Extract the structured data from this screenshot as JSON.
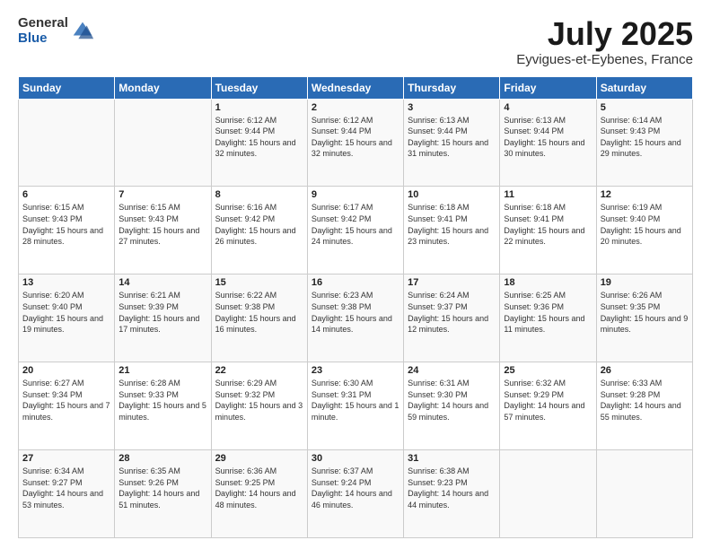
{
  "logo": {
    "general": "General",
    "blue": "Blue"
  },
  "header": {
    "month": "July 2025",
    "location": "Eyvigues-et-Eybenes, France"
  },
  "weekdays": [
    "Sunday",
    "Monday",
    "Tuesday",
    "Wednesday",
    "Thursday",
    "Friday",
    "Saturday"
  ],
  "weeks": [
    [
      {
        "day": "",
        "info": ""
      },
      {
        "day": "",
        "info": ""
      },
      {
        "day": "1",
        "info": "Sunrise: 6:12 AM\nSunset: 9:44 PM\nDaylight: 15 hours and 32 minutes."
      },
      {
        "day": "2",
        "info": "Sunrise: 6:12 AM\nSunset: 9:44 PM\nDaylight: 15 hours and 32 minutes."
      },
      {
        "day": "3",
        "info": "Sunrise: 6:13 AM\nSunset: 9:44 PM\nDaylight: 15 hours and 31 minutes."
      },
      {
        "day": "4",
        "info": "Sunrise: 6:13 AM\nSunset: 9:44 PM\nDaylight: 15 hours and 30 minutes."
      },
      {
        "day": "5",
        "info": "Sunrise: 6:14 AM\nSunset: 9:43 PM\nDaylight: 15 hours and 29 minutes."
      }
    ],
    [
      {
        "day": "6",
        "info": "Sunrise: 6:15 AM\nSunset: 9:43 PM\nDaylight: 15 hours and 28 minutes."
      },
      {
        "day": "7",
        "info": "Sunrise: 6:15 AM\nSunset: 9:43 PM\nDaylight: 15 hours and 27 minutes."
      },
      {
        "day": "8",
        "info": "Sunrise: 6:16 AM\nSunset: 9:42 PM\nDaylight: 15 hours and 26 minutes."
      },
      {
        "day": "9",
        "info": "Sunrise: 6:17 AM\nSunset: 9:42 PM\nDaylight: 15 hours and 24 minutes."
      },
      {
        "day": "10",
        "info": "Sunrise: 6:18 AM\nSunset: 9:41 PM\nDaylight: 15 hours and 23 minutes."
      },
      {
        "day": "11",
        "info": "Sunrise: 6:18 AM\nSunset: 9:41 PM\nDaylight: 15 hours and 22 minutes."
      },
      {
        "day": "12",
        "info": "Sunrise: 6:19 AM\nSunset: 9:40 PM\nDaylight: 15 hours and 20 minutes."
      }
    ],
    [
      {
        "day": "13",
        "info": "Sunrise: 6:20 AM\nSunset: 9:40 PM\nDaylight: 15 hours and 19 minutes."
      },
      {
        "day": "14",
        "info": "Sunrise: 6:21 AM\nSunset: 9:39 PM\nDaylight: 15 hours and 17 minutes."
      },
      {
        "day": "15",
        "info": "Sunrise: 6:22 AM\nSunset: 9:38 PM\nDaylight: 15 hours and 16 minutes."
      },
      {
        "day": "16",
        "info": "Sunrise: 6:23 AM\nSunset: 9:38 PM\nDaylight: 15 hours and 14 minutes."
      },
      {
        "day": "17",
        "info": "Sunrise: 6:24 AM\nSunset: 9:37 PM\nDaylight: 15 hours and 12 minutes."
      },
      {
        "day": "18",
        "info": "Sunrise: 6:25 AM\nSunset: 9:36 PM\nDaylight: 15 hours and 11 minutes."
      },
      {
        "day": "19",
        "info": "Sunrise: 6:26 AM\nSunset: 9:35 PM\nDaylight: 15 hours and 9 minutes."
      }
    ],
    [
      {
        "day": "20",
        "info": "Sunrise: 6:27 AM\nSunset: 9:34 PM\nDaylight: 15 hours and 7 minutes."
      },
      {
        "day": "21",
        "info": "Sunrise: 6:28 AM\nSunset: 9:33 PM\nDaylight: 15 hours and 5 minutes."
      },
      {
        "day": "22",
        "info": "Sunrise: 6:29 AM\nSunset: 9:32 PM\nDaylight: 15 hours and 3 minutes."
      },
      {
        "day": "23",
        "info": "Sunrise: 6:30 AM\nSunset: 9:31 PM\nDaylight: 15 hours and 1 minute."
      },
      {
        "day": "24",
        "info": "Sunrise: 6:31 AM\nSunset: 9:30 PM\nDaylight: 14 hours and 59 minutes."
      },
      {
        "day": "25",
        "info": "Sunrise: 6:32 AM\nSunset: 9:29 PM\nDaylight: 14 hours and 57 minutes."
      },
      {
        "day": "26",
        "info": "Sunrise: 6:33 AM\nSunset: 9:28 PM\nDaylight: 14 hours and 55 minutes."
      }
    ],
    [
      {
        "day": "27",
        "info": "Sunrise: 6:34 AM\nSunset: 9:27 PM\nDaylight: 14 hours and 53 minutes."
      },
      {
        "day": "28",
        "info": "Sunrise: 6:35 AM\nSunset: 9:26 PM\nDaylight: 14 hours and 51 minutes."
      },
      {
        "day": "29",
        "info": "Sunrise: 6:36 AM\nSunset: 9:25 PM\nDaylight: 14 hours and 48 minutes."
      },
      {
        "day": "30",
        "info": "Sunrise: 6:37 AM\nSunset: 9:24 PM\nDaylight: 14 hours and 46 minutes."
      },
      {
        "day": "31",
        "info": "Sunrise: 6:38 AM\nSunset: 9:23 PM\nDaylight: 14 hours and 44 minutes."
      },
      {
        "day": "",
        "info": ""
      },
      {
        "day": "",
        "info": ""
      }
    ]
  ]
}
